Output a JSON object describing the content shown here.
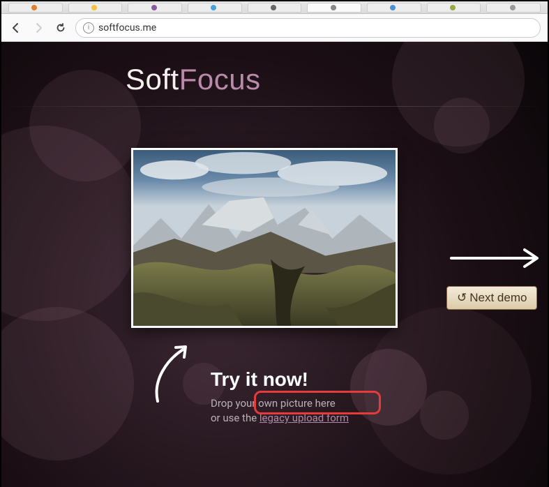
{
  "browser": {
    "url": "softfocus.me",
    "tabs": [
      {
        "favicon": "#e08030"
      },
      {
        "favicon": "#f7c13a"
      },
      {
        "favicon": "#8a5aa0"
      },
      {
        "favicon": "#4aa0e0"
      },
      {
        "favicon": "#666666"
      },
      {
        "favicon": "#888888",
        "active": true
      },
      {
        "favicon": "#4a90d9"
      },
      {
        "favicon": "#9aa844"
      },
      {
        "favicon": "#999999"
      }
    ]
  },
  "logo": {
    "part1": "Soft",
    "part2": "Focus"
  },
  "next_button": {
    "icon": "↺",
    "label": "Next demo"
  },
  "cta": {
    "heading": "Try it now!",
    "line1": "Drop your own picture here",
    "line2a": "or use the ",
    "link": "legacy upload form"
  }
}
